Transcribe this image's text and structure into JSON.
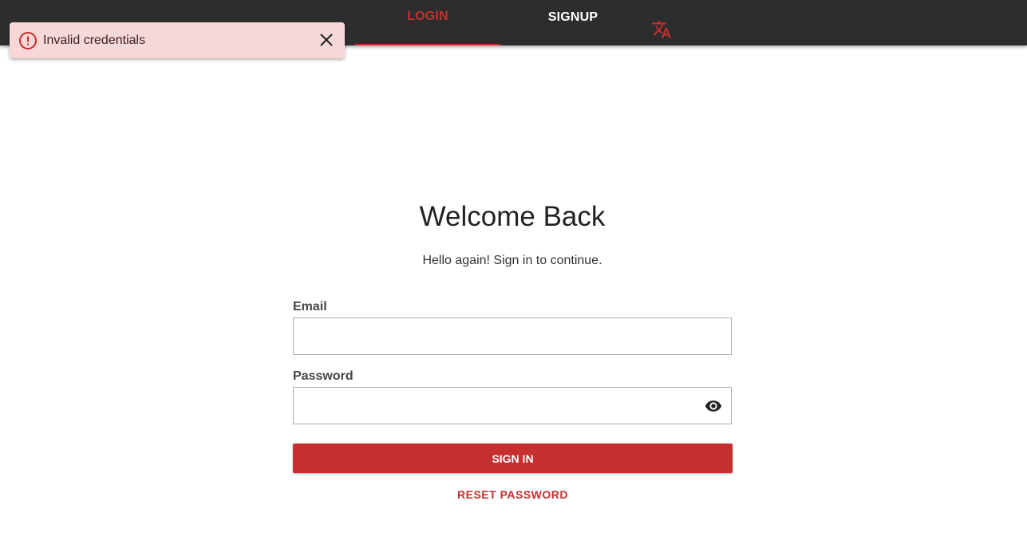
{
  "nav": {
    "tabs": [
      {
        "label": "LOGIN",
        "active": true
      },
      {
        "label": "SIGNUP",
        "active": false
      }
    ],
    "language_icon": "translate-icon"
  },
  "toast": {
    "message": "Invalid credentials",
    "icon": "error-icon",
    "close_icon": "close-icon"
  },
  "form": {
    "title": "Welcome Back",
    "subtitle": "Hello again! Sign in to continue.",
    "email": {
      "label": "Email",
      "value": "",
      "placeholder": ""
    },
    "password": {
      "label": "Password",
      "value": "",
      "placeholder": "",
      "toggle_icon": "eye-icon"
    },
    "submit_label": "SIGN IN",
    "reset_label": "RESET PASSWORD"
  },
  "colors": {
    "accent": "#c62f2f",
    "topbar": "#2d2d2d",
    "toast_bg": "#f8d7d7"
  }
}
